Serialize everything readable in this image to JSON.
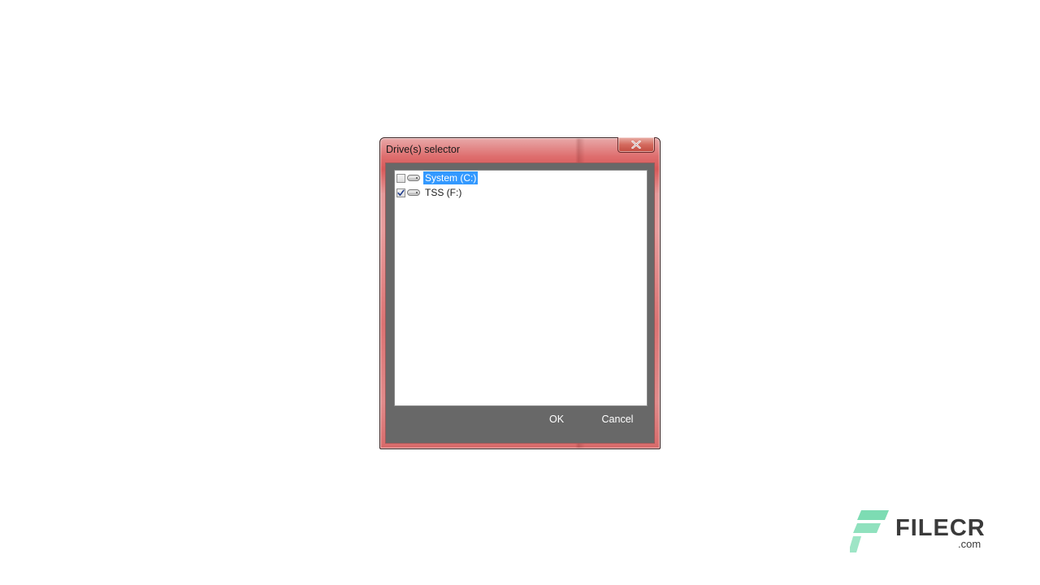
{
  "dialog": {
    "title": "Drive(s) selector",
    "close_icon": "close-icon",
    "drives": [
      {
        "label": "System (C:)",
        "checked": false,
        "selected": true,
        "icon": "drive-icon"
      },
      {
        "label": "TSS (F:)",
        "checked": true,
        "selected": false,
        "icon": "drive-icon"
      }
    ],
    "ok_label": "OK",
    "cancel_label": "Cancel"
  },
  "watermark": {
    "text": "FILECR",
    "suffix": ".com"
  },
  "colors": {
    "frame_accent": "#d85a5a",
    "client_bg": "#686868",
    "selection": "#3399ff",
    "watermark_logo": "#7ddcb3"
  }
}
